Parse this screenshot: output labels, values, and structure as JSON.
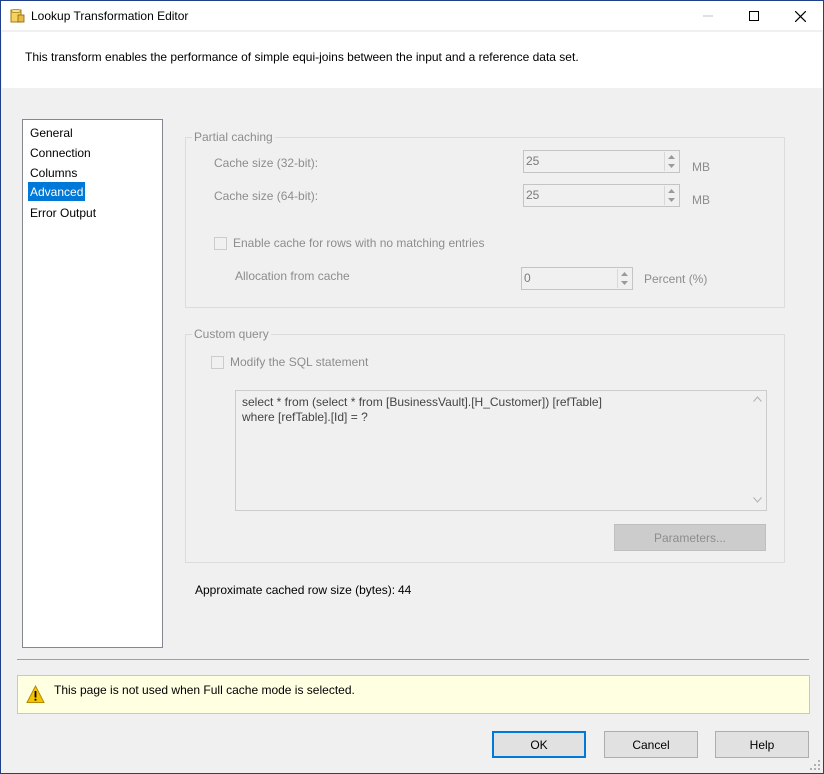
{
  "window": {
    "title": "Lookup Transformation Editor",
    "app_icon": "lookup-app-icon",
    "controls": [
      "minimize-icon",
      "maximize-icon",
      "close-icon"
    ]
  },
  "header": {
    "description": "This transform enables the performance of simple equi-joins between the input and a reference data set."
  },
  "nav": {
    "items": [
      {
        "label": "General",
        "selected": false
      },
      {
        "label": "Connection",
        "selected": false
      },
      {
        "label": "Columns",
        "selected": false
      },
      {
        "label": "Advanced",
        "selected": true
      },
      {
        "label": "Error Output",
        "selected": false
      }
    ]
  },
  "partial_caching": {
    "title": "Partial caching",
    "cache32_label": "Cache size (32-bit):",
    "cache32_value": "25",
    "cache32_unit": "MB",
    "cache64_label": "Cache size (64-bit):",
    "cache64_value": "25",
    "cache64_unit": "MB",
    "enable_label": "Enable cache for rows with no matching entries",
    "enable_checked": false,
    "allocation_label": "Allocation from cache",
    "allocation_value": "0",
    "allocation_unit": "Percent (%)"
  },
  "custom_query": {
    "title": "Custom query",
    "modify_label": "Modify the SQL statement",
    "modify_checked": false,
    "sql_line1": "select * from (select * from [BusinessVault].[H_Customer]) [refTable]",
    "sql_line2": "where [refTable].[Id] = ?",
    "parameters_label": "Parameters..."
  },
  "approx": {
    "label": "Approximate cached row size (bytes):",
    "value": "44"
  },
  "warning": {
    "icon": "warning-icon",
    "text": "This page is not used when Full cache mode is selected."
  },
  "buttons": {
    "ok": "OK",
    "cancel": "Cancel",
    "help": "Help"
  },
  "colors": {
    "accent": "#0078d7",
    "warning_bg": "#ffffe1",
    "disabled_text": "#8d8d8d"
  }
}
